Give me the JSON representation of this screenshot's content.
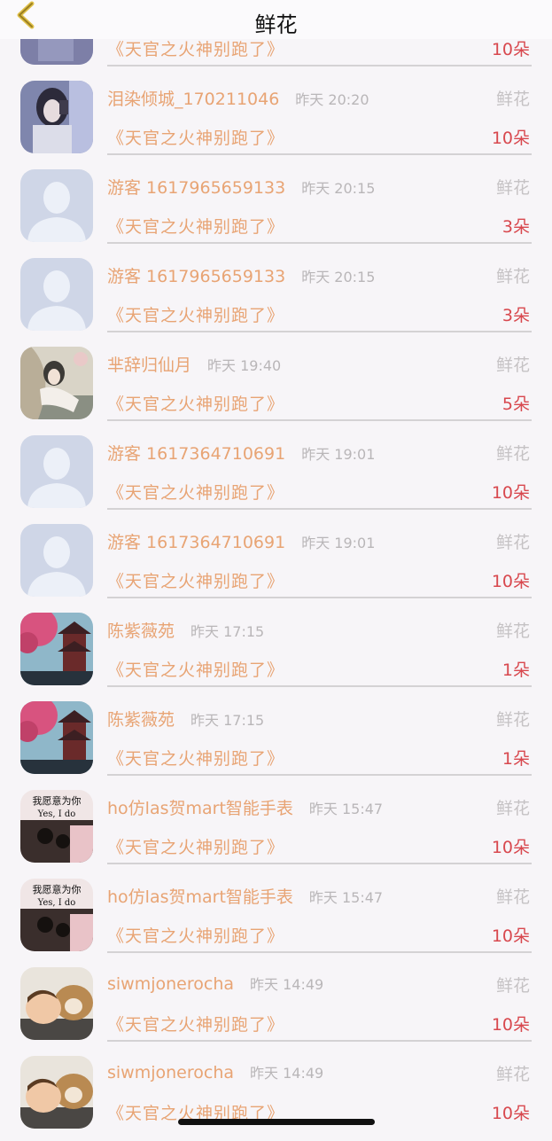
{
  "header": {
    "title": "鲜花"
  },
  "colors": {
    "name": "#e8a474",
    "quantity": "#d8484e",
    "muted": "#b9b6b8"
  },
  "items": [
    {
      "avatar": "artistic-photo-icon",
      "name": "",
      "time": "",
      "type": "",
      "book": "《天官之火神别跑了》",
      "qty": "10朵"
    },
    {
      "avatar": "girl-photo-icon",
      "name": "泪染倾城_170211046",
      "time": "昨天 20:20",
      "type": "鲜花",
      "book": "《天官之火神别跑了》",
      "qty": "10朵"
    },
    {
      "avatar": "default-user-icon",
      "name": "游客 1617965659133",
      "time": "昨天 20:15",
      "type": "鲜花",
      "book": "《天官之火神别跑了》",
      "qty": "3朵"
    },
    {
      "avatar": "default-user-icon",
      "name": "游客 1617965659133",
      "time": "昨天 20:15",
      "type": "鲜花",
      "book": "《天官之火神别跑了》",
      "qty": "3朵"
    },
    {
      "avatar": "anime-figure-icon",
      "name": "芈辞归仙月",
      "time": "昨天 19:40",
      "type": "鲜花",
      "book": "《天官之火神别跑了》",
      "qty": "5朵"
    },
    {
      "avatar": "default-user-icon",
      "name": "游客 1617364710691",
      "time": "昨天 19:01",
      "type": "鲜花",
      "book": "《天官之火神别跑了》",
      "qty": "10朵"
    },
    {
      "avatar": "default-user-icon",
      "name": "游客 1617364710691",
      "time": "昨天 19:01",
      "type": "鲜花",
      "book": "《天官之火神别跑了》",
      "qty": "10朵"
    },
    {
      "avatar": "pagoda-painting-icon",
      "name": "陈紫薇苑",
      "time": "昨天 17:15",
      "type": "鲜花",
      "book": "《天官之火神别跑了》",
      "qty": "1朵"
    },
    {
      "avatar": "pagoda-painting-icon",
      "name": "陈紫薇苑",
      "time": "昨天 17:15",
      "type": "鲜花",
      "book": "《天官之火神别跑了》",
      "qty": "1朵"
    },
    {
      "avatar": "yes-i-do-icon",
      "avatar_text1": "我愿意为你",
      "avatar_text2": "Yes, I do",
      "name": "ho仿las贺mart智能手表",
      "time": "昨天 15:47",
      "type": "鲜花",
      "book": "《天官之火神别跑了》",
      "qty": "10朵"
    },
    {
      "avatar": "yes-i-do-icon",
      "avatar_text1": "我愿意为你",
      "avatar_text2": "Yes, I do",
      "name": "ho仿las贺mart智能手表",
      "time": "昨天 15:47",
      "type": "鲜花",
      "book": "《天官之火神别跑了》",
      "qty": "10朵"
    },
    {
      "avatar": "baby-dog-icon",
      "name": "siwmjonerocha",
      "time": "昨天 14:49",
      "type": "鲜花",
      "book": "《天官之火神别跑了》",
      "qty": "10朵"
    },
    {
      "avatar": "baby-dog-icon",
      "name": "siwmjonerocha",
      "time": "昨天 14:49",
      "type": "鲜花",
      "book": "《天官之火神别跑了》",
      "qty": "10朵"
    }
  ]
}
